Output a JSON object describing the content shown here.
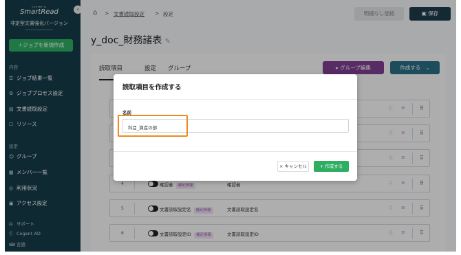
{
  "sidebar": {
    "brand_small": "COGENT AI",
    "brand": "SmartRead",
    "brand_subtitle": "非定型文書強化バージョン",
    "collapse_icon": "‹",
    "new_job_label": "＋ジョブを新規作成",
    "section_content": "内容",
    "content_items": [
      {
        "icon": "☰",
        "label": "ジョブ結果一覧"
      },
      {
        "icon": "⚙",
        "label": "ジョブプロセス設定"
      },
      {
        "icon": "▤",
        "label": "文書読取設定"
      },
      {
        "icon": "☐",
        "label": "リソース"
      }
    ],
    "section_settings": "設定",
    "settings_items": [
      {
        "icon": "☺",
        "label": "グループ"
      },
      {
        "icon": "▦",
        "label": "メンバー一覧"
      },
      {
        "icon": "◎",
        "label": "利用状況"
      },
      {
        "icon": "▣",
        "label": "アクセス設定"
      }
    ],
    "footer_items": [
      {
        "icon": "☊",
        "label": "サポート"
      },
      {
        "icon": "Ⓒ",
        "label": "Cogent AD"
      },
      {
        "icon": "⌨",
        "label": "言語"
      }
    ]
  },
  "header": {
    "home_icon": "⌂",
    "breadcrumb": [
      "文書読取設定",
      "設定"
    ],
    "separator": ">",
    "nodoc_price_label": "明細なし価格",
    "save_label": "保存",
    "save_icon": "▣"
  },
  "page": {
    "title": "y_doc_財務諸表",
    "edit_icon": "✎",
    "tabs": [
      "読取項目",
      "設定",
      "グループ"
    ],
    "group_edit_label": "グループ編集",
    "group_edit_icon": "▸",
    "create_label": "作成する",
    "create_chevron": "⌄"
  },
  "rows": [
    {
      "num": "4",
      "name": "確認者",
      "badge": "補足情報",
      "value": "確認者"
    },
    {
      "num": "5",
      "name": "文書読取設定名",
      "badge": "補足情報",
      "value": "文書読取設定名"
    },
    {
      "num": "6",
      "name": "文書読取設定ID",
      "badge": "補足情報",
      "value": "文書読取設定ID"
    }
  ],
  "row_icons": {
    "copy": "⎘",
    "settings": "≡",
    "drag": "⠿"
  },
  "modal": {
    "title": "読取項目を作成する",
    "field_label": "名前",
    "field_value": "科目_資産の部",
    "cancel_label": "× キャンセル",
    "submit_label": "+ 作成する"
  },
  "colors": {
    "sidebar": "#163b48",
    "accent_green": "#2fae62",
    "group_purple": "#7d3e90",
    "create_teal": "#2a6d86",
    "highlight": "#ee8a1e"
  }
}
